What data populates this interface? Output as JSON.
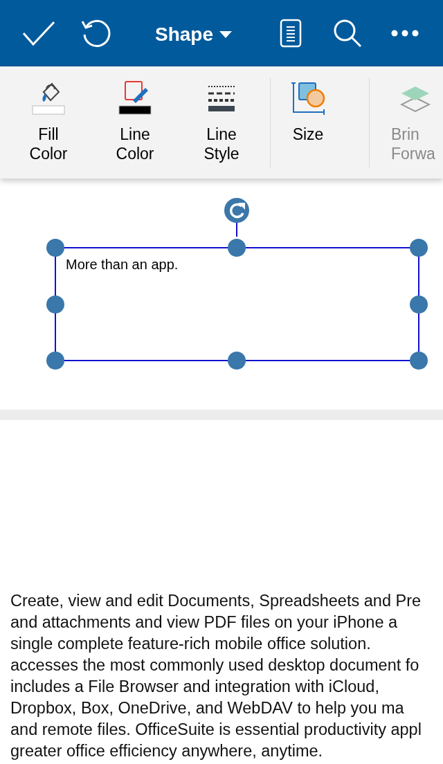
{
  "header": {
    "title": "Shape"
  },
  "toolbar": [
    {
      "kind": "fill",
      "label": "Fill\nColor",
      "disabled": false
    },
    {
      "kind": "line-color",
      "label": "Line\nColor",
      "disabled": false
    },
    {
      "kind": "line-style",
      "label": "Line\nStyle",
      "disabled": false
    },
    {
      "kind": "size",
      "label": "Size",
      "disabled": false
    },
    {
      "kind": "bring-forward",
      "label": "Brin\nForwa",
      "disabled": true
    }
  ],
  "shape": {
    "text": "More than an app.",
    "selected": true
  },
  "body_lines": [
    "Create, view and edit Documents, Spreadsheets and Pre",
    "and attachments and view PDF files on your iPhone a",
    "single complete feature-rich mobile office solution.",
    "accesses the most commonly used desktop document fo",
    "includes a File Browser and integration with iCloud,",
    "Dropbox, Box, OneDrive, and WebDAV to help you ma",
    "and remote files. OfficeSuite is essential productivity appl",
    "greater office efficiency anywhere, anytime."
  ]
}
